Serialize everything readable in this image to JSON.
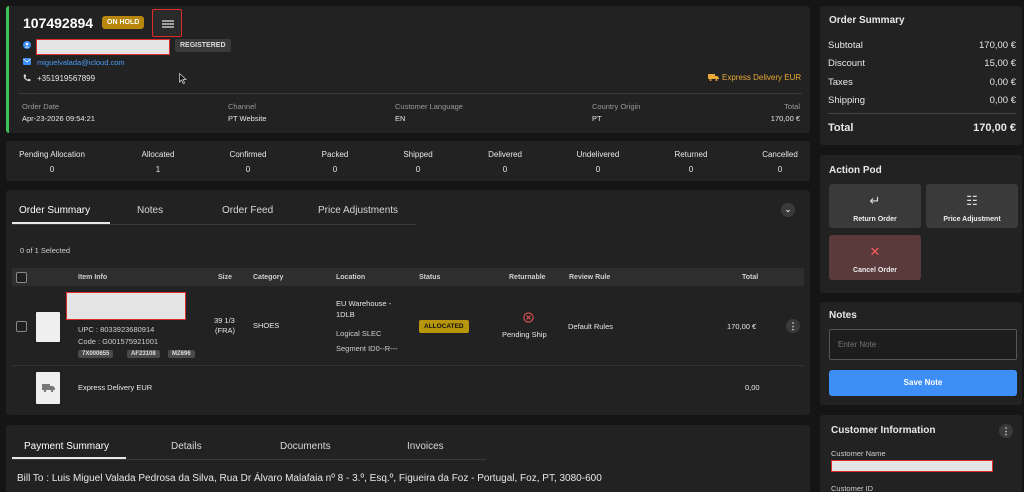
{
  "order": {
    "number": "107492894",
    "status_badge": "ON HOLD",
    "registered_tag": "REGISTERED",
    "email": "miguelvalada@icloud.com",
    "phone": "+351919567899",
    "delivery_method": "Express Delivery EUR",
    "details": {
      "order_date_label": "Order Date",
      "order_date": "Apr-23-2026 09:54:21",
      "channel_label": "Channel",
      "channel": "PT Website",
      "language_label": "Customer Language",
      "language": "EN",
      "country_label": "Country Origin",
      "country": "PT",
      "total_label": "Total",
      "total": "170,00 €"
    }
  },
  "statuses": [
    {
      "label": "Pending Allocation",
      "value": "0"
    },
    {
      "label": "Allocated",
      "value": "1"
    },
    {
      "label": "Confirmed",
      "value": "0"
    },
    {
      "label": "Packed",
      "value": "0"
    },
    {
      "label": "Shipped",
      "value": "0"
    },
    {
      "label": "Delivered",
      "value": "0"
    },
    {
      "label": "Undelivered",
      "value": "0"
    },
    {
      "label": "Returned",
      "value": "0"
    },
    {
      "label": "Cancelled",
      "value": "0"
    }
  ],
  "main_tabs": [
    "Order Summary",
    "Notes",
    "Order Feed",
    "Price Adjustments"
  ],
  "selection_text": "0 of 1 Selected",
  "table": {
    "headers": [
      "Item Info",
      "Size",
      "Category",
      "Location",
      "Status",
      "Returnable",
      "Review Rule",
      "Total"
    ],
    "item": {
      "upc": "UPC : 8033923680914",
      "code": "Code : G001575921001",
      "chips": [
        "7X000655",
        "AF23108",
        "MZ696"
      ],
      "size": "39 1/3",
      "size_sub": "(FRA)",
      "category": "SHOES",
      "location_line1": "EU Warehouse -",
      "location_line2": "1DLB",
      "location_logical": "Logical SLEC",
      "location_segment": "Segment ID0--R---",
      "status": "ALLOCATED",
      "returnable": "Pending Ship",
      "review_rule": "Default Rules",
      "total": "170,00 €"
    },
    "shipping_row": {
      "name": "Express Delivery EUR",
      "total": "0,00"
    }
  },
  "bottom_tabs": [
    "Payment Summary",
    "Details",
    "Documents",
    "Invoices"
  ],
  "bill_to": "Bill To : Luis Miguel Valada Pedrosa da Silva, Rua Dr Álvaro Malafaia nº 8 - 3.º, Esq.º, Figueira da Foz - Portugal, Foz, PT, 3080-600",
  "summary": {
    "title": "Order Summary",
    "rows": [
      {
        "label": "Subtotal",
        "value": "170,00 €"
      },
      {
        "label": "Discount",
        "value": "15,00 €"
      },
      {
        "label": "Taxes",
        "value": "0,00 €"
      },
      {
        "label": "Shipping",
        "value": "0,00 €"
      }
    ],
    "total_label": "Total",
    "total_value": "170,00 €"
  },
  "action_pod": {
    "title": "Action Pod",
    "return_order": "Return Order",
    "price_adjustment": "Price Adjustment",
    "cancel_order": "Cancel Order"
  },
  "notes": {
    "title": "Notes",
    "placeholder": "Enter Note",
    "save_label": "Save Note"
  },
  "customer": {
    "title": "Customer Information",
    "name_label": "Customer Name",
    "id_label": "Customer ID"
  },
  "colors": {
    "accent_green": "#3cc25a",
    "save_blue": "#3d8ef5",
    "on_hold": "#b8860b",
    "cancel_red": "#e05555"
  }
}
